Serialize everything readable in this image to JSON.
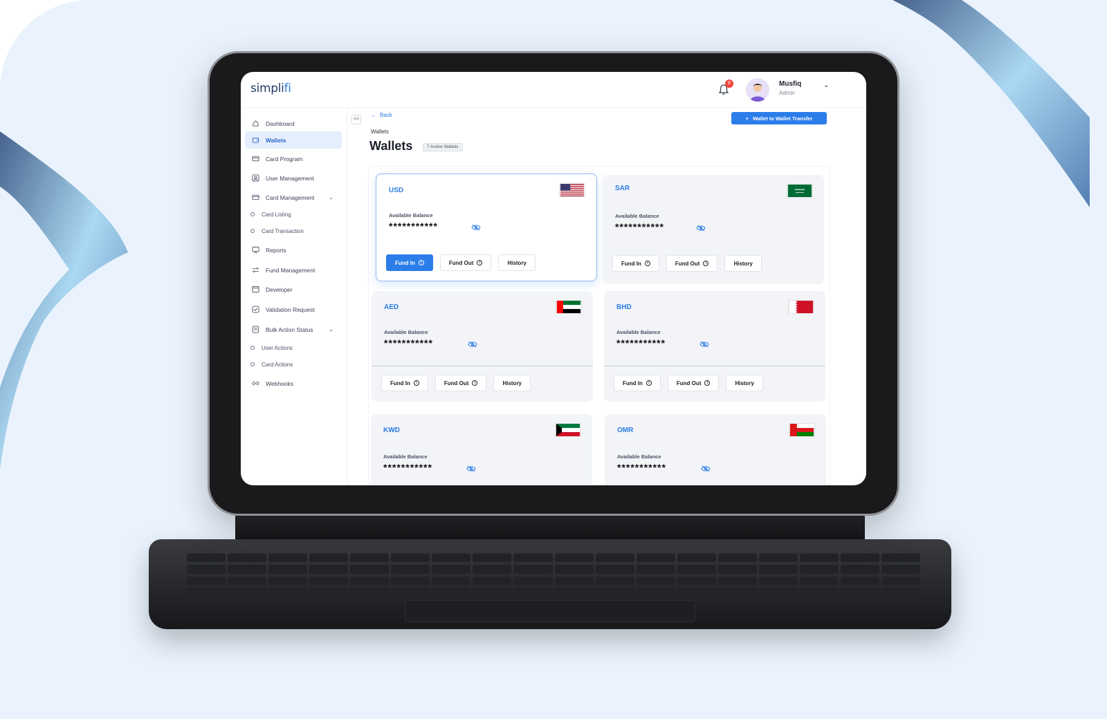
{
  "app": {
    "logo_text": "simpli",
    "logo_accent": "fi"
  },
  "header": {
    "notifications": "8",
    "user": {
      "name": "Musfiq",
      "role": "Admin"
    }
  },
  "sidebar": {
    "items": [
      {
        "label": "Dashboard",
        "icon": "home-icon"
      },
      {
        "label": "Wallets",
        "icon": "wallet-icon",
        "active": true
      },
      {
        "label": "Card Program",
        "icon": "card-icon"
      },
      {
        "label": "User Management",
        "icon": "user-icon"
      },
      {
        "label": "Card Management",
        "icon": "card-icon",
        "expandable": true
      },
      {
        "label": "Card Listing",
        "sub": true
      },
      {
        "label": "Card Transaction",
        "sub": true
      },
      {
        "label": "Reports",
        "icon": "report-icon"
      },
      {
        "label": "Fund Management",
        "icon": "transfer-icon"
      },
      {
        "label": "Developer",
        "icon": "code-icon"
      },
      {
        "label": "Validation Request",
        "icon": "check-icon"
      },
      {
        "label": "Bulk Action Status",
        "icon": "doc-icon",
        "expandable": true
      },
      {
        "label": "User Actions",
        "sub": true
      },
      {
        "label": "Card Actions",
        "sub": true
      },
      {
        "label": "Webhooks",
        "icon": "link-icon"
      }
    ]
  },
  "main": {
    "back_label": "Back",
    "breadcrumb": "Wallets",
    "title": "Wallets",
    "count_badge": "7 Active Wallets",
    "transfer_button": "Wallet to Wallet Transfer"
  },
  "wallets": [
    {
      "code": "USD",
      "balance_label": "Available Balance",
      "balance": "***********",
      "fund_in": "Fund In",
      "fund_out": "Fund Out",
      "history": "History"
    },
    {
      "code": "SAR",
      "balance_label": "Available Balance",
      "balance": "***********",
      "fund_in": "Fund In",
      "fund_out": "Fund Out",
      "history": "History"
    },
    {
      "code": "AED",
      "balance_label": "Available Balance",
      "balance": "***********",
      "fund_in": "Fund In",
      "fund_out": "Fund Out",
      "history": "History"
    },
    {
      "code": "BHD",
      "balance_label": "Available Balance",
      "balance": "***********",
      "fund_in": "Fund In",
      "fund_out": "Fund Out",
      "history": "History"
    },
    {
      "code": "KWD",
      "balance_label": "Available Balance",
      "balance": "***********"
    },
    {
      "code": "OMR",
      "balance_label": "Available Balance",
      "balance": "***********"
    }
  ],
  "colors": {
    "accent": "#2b7de9",
    "background": "#eaf3fd",
    "card": "#f2f4f7"
  }
}
